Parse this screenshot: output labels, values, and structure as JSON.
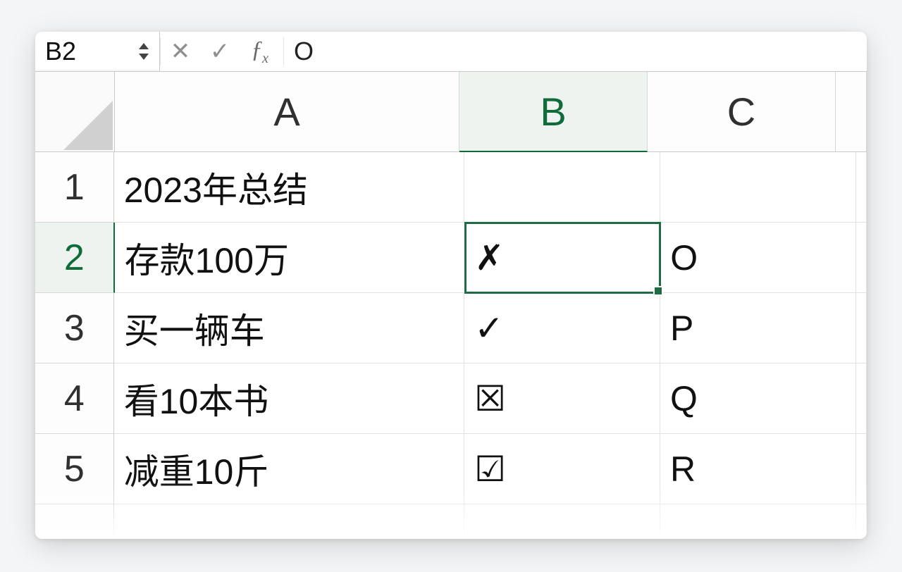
{
  "formula_bar": {
    "name_box": "B2",
    "cancel_icon": "✕",
    "enter_icon": "✓",
    "fx_label": "fx",
    "value": "O"
  },
  "columns": [
    "A",
    "B",
    "C",
    ""
  ],
  "active_column_index": 1,
  "active_row_index": 1,
  "rows": [
    {
      "n": "1",
      "A": "2023年总结",
      "B": "",
      "C": ""
    },
    {
      "n": "2",
      "A": "存款100万",
      "B": "✗",
      "C": "O"
    },
    {
      "n": "3",
      "A": "买一辆车",
      "B": "✓",
      "C": "P"
    },
    {
      "n": "4",
      "A": "看10本书",
      "B": "☒",
      "C": "Q"
    },
    {
      "n": "5",
      "A": "减重10斤",
      "B": "☑",
      "C": "R"
    }
  ],
  "selected_cell": "B2"
}
